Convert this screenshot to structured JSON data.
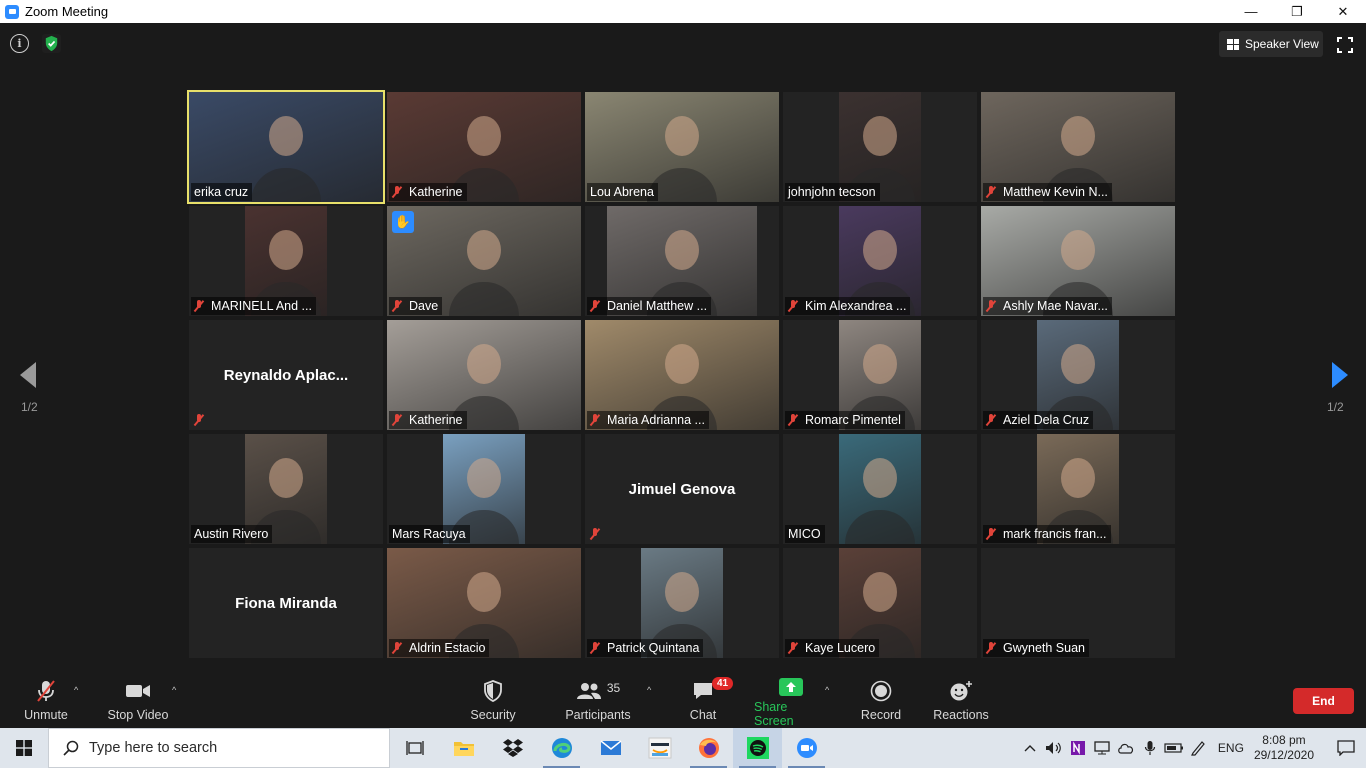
{
  "window": {
    "title": "Zoom Meeting",
    "minimize": "—",
    "maximize": "❐",
    "close": "✕"
  },
  "meeting": {
    "view_button": "Speaker View",
    "page_left": "1/2",
    "page_right": "1/2"
  },
  "participants": [
    {
      "name": "erika cruz",
      "muted": false,
      "video": "full",
      "active": true,
      "bg": "#3a4a66"
    },
    {
      "name": "Katherine",
      "muted": true,
      "video": "full",
      "bg": "#5a3a34"
    },
    {
      "name": "Lou Abrena",
      "muted": false,
      "video": "full",
      "bg": "#8a8672"
    },
    {
      "name": "johnjohn tecson",
      "muted": false,
      "video": "center",
      "bg": "#3b3130"
    },
    {
      "name": "Matthew Kevin N...",
      "muted": true,
      "video": "full",
      "bg": "#6e665d"
    },
    {
      "name": "MARINELL And ...",
      "muted": true,
      "video": "center",
      "bg": "#4a3230"
    },
    {
      "name": "Dave",
      "muted": true,
      "video": "full",
      "bg": "#6d6860",
      "hand": true
    },
    {
      "name": "Daniel Matthew ...",
      "muted": true,
      "video": "center-wide",
      "bg": "#6f6a68"
    },
    {
      "name": "Kim Alexandrea ...",
      "muted": true,
      "video": "center",
      "bg": "#4a3a5e"
    },
    {
      "name": "Ashly Mae Navar...",
      "muted": true,
      "video": "full",
      "bg": "#a8aaa6"
    },
    {
      "name": "Reynaldo  Aplac...",
      "muted": true,
      "video": "none"
    },
    {
      "name": "Katherine",
      "muted": true,
      "video": "full",
      "bg": "#a49e98"
    },
    {
      "name": "Maria Adrianna ...",
      "muted": true,
      "video": "full",
      "bg": "#a08a6a"
    },
    {
      "name": "Romarc Pimentel",
      "muted": true,
      "video": "center",
      "bg": "#8e8680"
    },
    {
      "name": "Aziel Dela Cruz",
      "muted": true,
      "video": "center",
      "bg": "#5a6a7a"
    },
    {
      "name": "Austin Rivero",
      "muted": false,
      "video": "center",
      "bg": "#5a5048"
    },
    {
      "name": "Mars Racuya",
      "muted": false,
      "video": "center",
      "bg": "#7aa0c0"
    },
    {
      "name": "Jimuel Genova",
      "muted": true,
      "video": "none"
    },
    {
      "name": "MICO",
      "muted": false,
      "video": "center",
      "bg": "#3a6a7a"
    },
    {
      "name": "mark francis fran...",
      "muted": true,
      "video": "center",
      "bg": "#7a6a58"
    },
    {
      "name": "Fiona Miranda",
      "muted": false,
      "video": "none"
    },
    {
      "name": "Aldrin Estacio",
      "muted": true,
      "video": "full",
      "bg": "#7a5a48"
    },
    {
      "name": "Patrick Quintana",
      "muted": true,
      "video": "center",
      "bg": "#6a7a84"
    },
    {
      "name": "Kaye Lucero",
      "muted": true,
      "video": "center",
      "bg": "#5a4038"
    },
    {
      "name": "Gwyneth Suan",
      "muted": true,
      "video": "blank"
    }
  ],
  "toolbar": {
    "unmute": "Unmute",
    "stop_video": "Stop Video",
    "security": "Security",
    "participants": "Participants",
    "participants_count": "35",
    "chat": "Chat",
    "chat_badge": "41",
    "share_screen": "Share Screen",
    "record": "Record",
    "reactions": "Reactions",
    "end": "End"
  },
  "taskbar": {
    "search_placeholder": "Type here to search",
    "language": "ENG",
    "time": "8:08 pm",
    "date": "29/12/2020"
  }
}
